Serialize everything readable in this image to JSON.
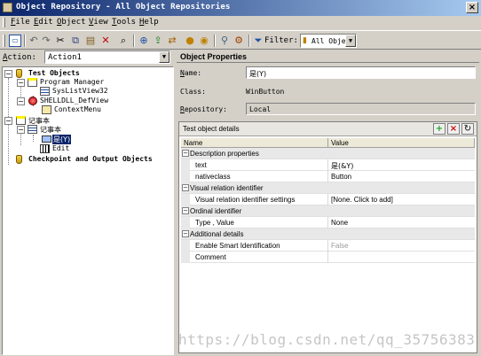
{
  "window": {
    "title": "Object Repository - All Object Repositories",
    "close_glyph": "×"
  },
  "menubar": {
    "items": [
      {
        "key": "F",
        "rest": "ile"
      },
      {
        "key": "E",
        "rest": "dit"
      },
      {
        "key": "O",
        "rest": "bject"
      },
      {
        "key": "V",
        "rest": "iew"
      },
      {
        "key": "T",
        "rest": "ools"
      },
      {
        "key": "H",
        "rest": "elp"
      }
    ]
  },
  "toolbar": {
    "icons": [
      "object-icon",
      "undo-icon",
      "redo-icon",
      "cut-icon",
      "copy-icon",
      "paste-icon",
      "delete-icon",
      "find-icon",
      "add-objects-icon",
      "export-icon",
      "merge-icon",
      "highlight-icon",
      "locate-icon",
      "object-spy-icon",
      "associate-icon"
    ],
    "filter_label": "Filter:",
    "filter_value": "All Obje"
  },
  "action": {
    "label_key": "A",
    "label_rest": "ction:",
    "value": "Action1"
  },
  "tree": {
    "root": "Test Objects",
    "program_manager": "Program Manager",
    "syslistview": "SysListView32",
    "shelldll": "SHELLDLL_DefView",
    "contextmenu": "ContextMenu",
    "notepad_window": "记事本",
    "notepad_child": "记事本",
    "selected_button": "是(Y)",
    "edit": "Edit",
    "checkpoints": "Checkpoint and Output Objects"
  },
  "properties": {
    "header": "Object Properties",
    "name_label_key": "N",
    "name_label_rest": "ame:",
    "name_value": "是(Y)",
    "class_label": "Class:",
    "class_value": "WinButton",
    "repo_label_key": "R",
    "repo_label_rest": "epository:",
    "repo_value": "Local"
  },
  "details": {
    "title": "Test object details",
    "add_glyph": "+",
    "remove_glyph": "×",
    "refresh_glyph": "↻",
    "columns": [
      "Name",
      "Value"
    ],
    "rows": [
      {
        "type": "category",
        "name": "Description properties"
      },
      {
        "type": "prop",
        "name": "text",
        "value": "是(&Y)"
      },
      {
        "type": "prop",
        "name": "nativeclass",
        "value": "Button"
      },
      {
        "type": "category",
        "name": "Visual relation identifier"
      },
      {
        "type": "prop",
        "name": "Visual relation identifier settings",
        "value": "[None. Click to add]"
      },
      {
        "type": "category",
        "name": "Ordinal identifier"
      },
      {
        "type": "prop",
        "name": "Type , Value",
        "value": "None"
      },
      {
        "type": "category",
        "name": "Additional details"
      },
      {
        "type": "prop",
        "name": "Enable Smart Identification",
        "value": "False"
      },
      {
        "type": "prop",
        "name": "Comment",
        "value": ""
      }
    ]
  },
  "watermark": "https://blog.csdn.net/qq_35756383"
}
